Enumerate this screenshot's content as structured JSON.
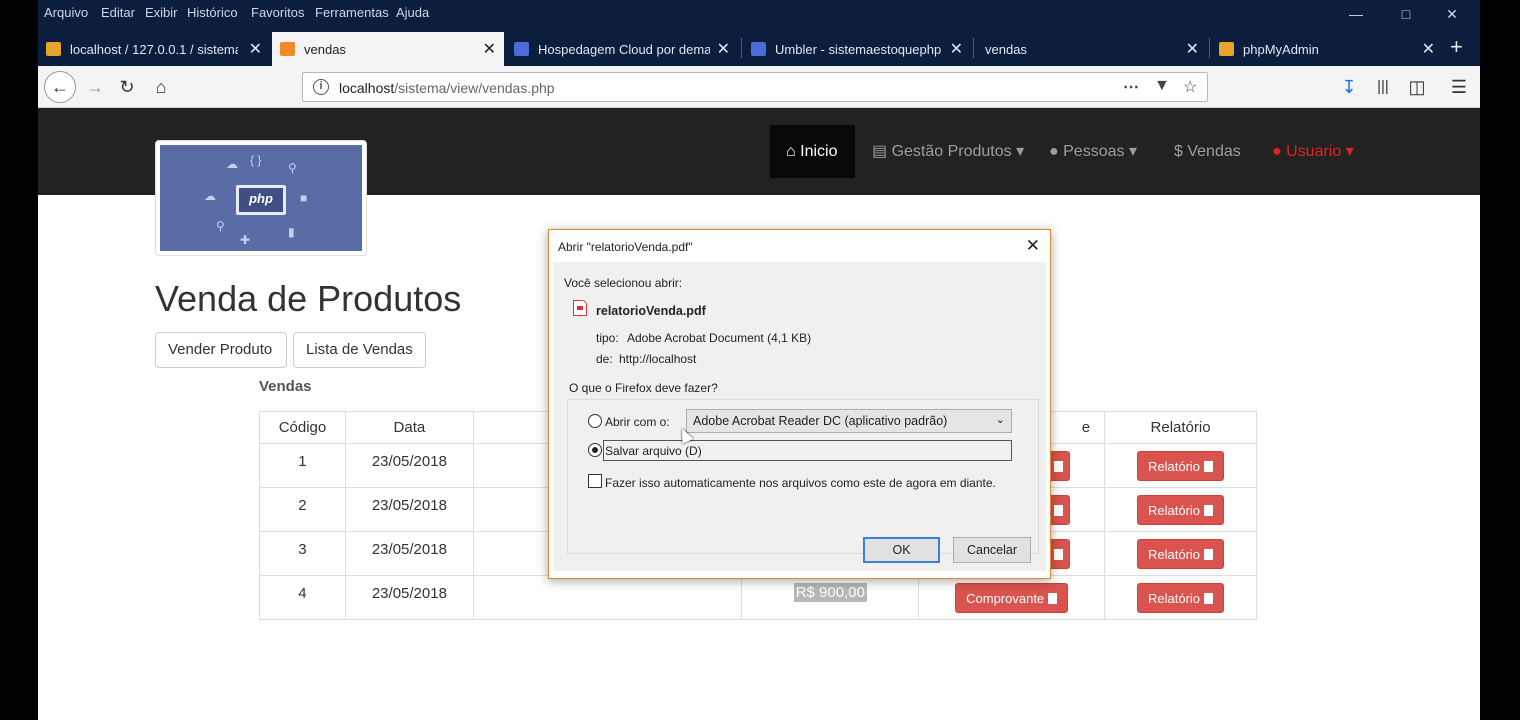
{
  "menu": [
    "Arquivo",
    "Editar",
    "Exibir",
    "Histórico",
    "Favoritos",
    "Ferramentas",
    "Ajuda"
  ],
  "tabs": [
    {
      "label": "localhost / 127.0.0.1 / sistema",
      "icon_color": "#e7a32a"
    },
    {
      "label": "vendas",
      "icon_color": "#f08a24"
    },
    {
      "label": "Hospedagem Cloud por dema",
      "icon_color": "#4a6bd8"
    },
    {
      "label": "Umbler - sistemaestoquephp.",
      "icon_color": "#4a6bd8"
    },
    {
      "label": "vendas",
      "icon_color": ""
    },
    {
      "label": "phpMyAdmin",
      "icon_color": "#e7a32a"
    }
  ],
  "address": {
    "host": "localhost",
    "path": "/sistema/view/vendas.php"
  },
  "site_nav": {
    "inicio": "Inicio",
    "gestao": "Gestão Produtos",
    "pessoas": "Pessoas",
    "vendas": "Vendas",
    "usuario": "Usuario",
    "dollar": "$"
  },
  "logo_text": "php",
  "page_title": "Venda de Produtos",
  "buttons": {
    "vender": "Vender Produto",
    "lista": "Lista de Vendas"
  },
  "section_label": "Vendas",
  "table": {
    "headers": {
      "codigo": "Código",
      "data": "Data",
      "partial": "e",
      "relatorio": "Relatório"
    },
    "rows": [
      {
        "codigo": "1",
        "data": "23/05/2018"
      },
      {
        "codigo": "2",
        "data": "23/05/2018"
      },
      {
        "codigo": "3",
        "data": "23/05/2018"
      },
      {
        "codigo": "4",
        "data": "23/05/2018",
        "valor": "R$ 900,00",
        "comprovante": "Comprovante"
      }
    ],
    "relatorio_label": "Relatório"
  },
  "dialog": {
    "title": "Abrir \"relatorioVenda.pdf\"",
    "selected_label": "Você selecionou abrir:",
    "filename": "relatorioVenda.pdf",
    "type_label": "tipo:",
    "type_value": "Adobe Acrobat Document (4,1 KB)",
    "from_label": "de:",
    "from_value": "http://localhost",
    "question": "O que o Firefox deve fazer?",
    "open_with": "Abrir com o:",
    "app": "Adobe Acrobat Reader DC  (aplicativo padrão)",
    "save": "Salvar arquivo (D)",
    "auto": "Fazer isso automaticamente nos arquivos como este de agora em diante.",
    "ok": "OK",
    "cancel": "Cancelar"
  }
}
